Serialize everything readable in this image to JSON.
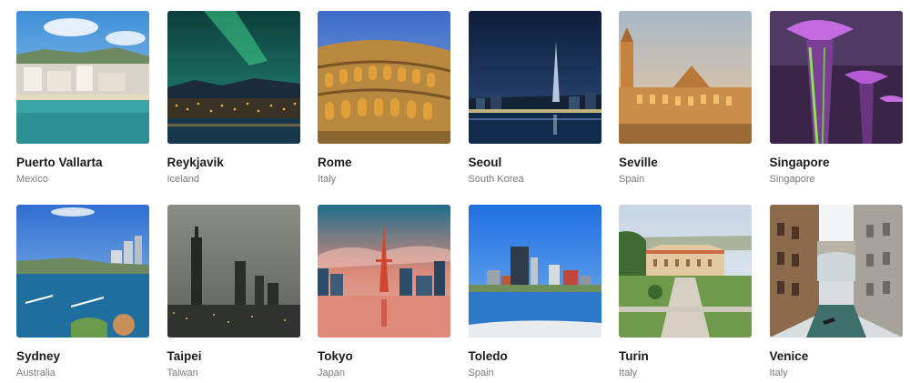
{
  "destinations": [
    {
      "name": "Puerto Vallarta",
      "country": "Mexico"
    },
    {
      "name": "Reykjavik",
      "country": "Iceland"
    },
    {
      "name": "Rome",
      "country": "Italy"
    },
    {
      "name": "Seoul",
      "country": "South Korea"
    },
    {
      "name": "Seville",
      "country": "Spain"
    },
    {
      "name": "Singapore",
      "country": "Singapore"
    },
    {
      "name": "Sydney",
      "country": "Australia"
    },
    {
      "name": "Taipei",
      "country": "Taiwan"
    },
    {
      "name": "Tokyo",
      "country": "Japan"
    },
    {
      "name": "Toledo",
      "country": "Spain"
    },
    {
      "name": "Turin",
      "country": "Italy"
    },
    {
      "name": "Venice",
      "country": "Italy"
    }
  ]
}
